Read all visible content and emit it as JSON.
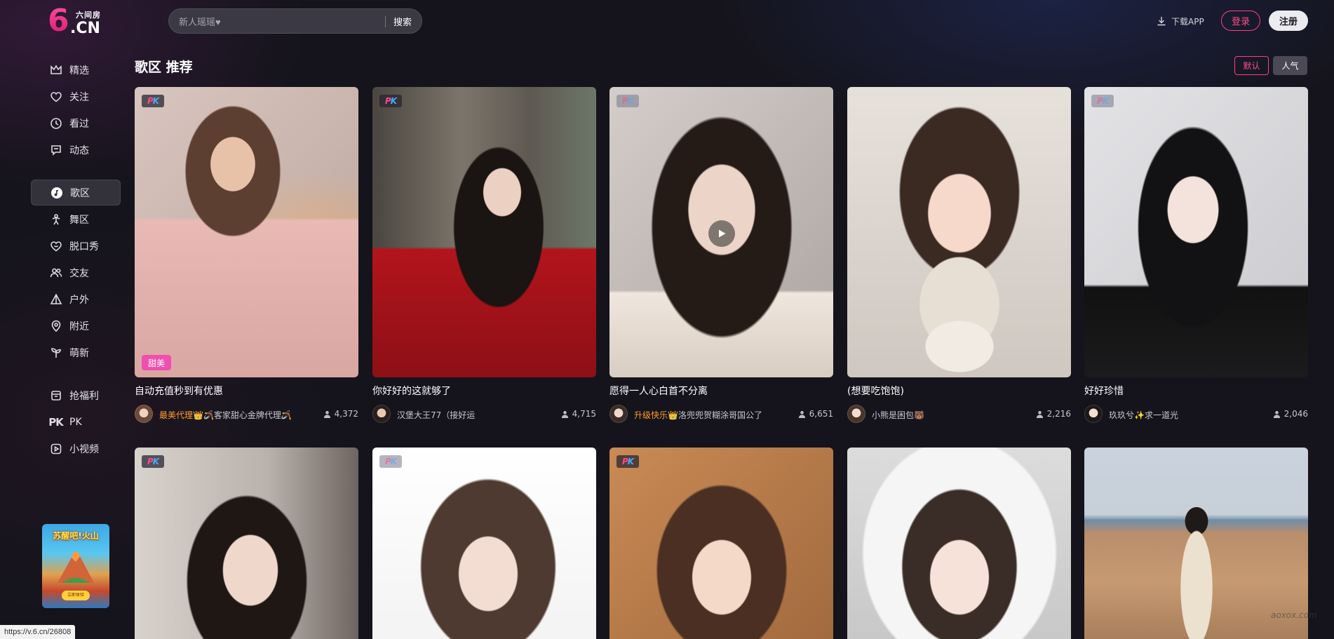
{
  "colors": {
    "accent_pink": "#ff3f7e",
    "background": "#15141c",
    "tag_pink": "#f04fb0",
    "highlight_orange": "#ff9b2a"
  },
  "header": {
    "logo_top": "六间房",
    "logo_six": "6",
    "logo_cn": ".CN",
    "search_placeholder": "新人瑶瑶♥",
    "search_button": "搜索",
    "download_label": "下载APP",
    "login_label": "登录",
    "register_label": "注册"
  },
  "sidebar": {
    "items": [
      {
        "label": "精选",
        "icon": "crown-icon"
      },
      {
        "label": "关注",
        "icon": "heart-icon"
      },
      {
        "label": "看过",
        "icon": "clock-icon"
      },
      {
        "label": "动态",
        "icon": "message-icon"
      },
      {
        "label": "歌区",
        "icon": "music-note-icon",
        "active": true
      },
      {
        "label": "舞区",
        "icon": "dance-icon"
      },
      {
        "label": "脱口秀",
        "icon": "smile-icon"
      },
      {
        "label": "交友",
        "icon": "users-icon"
      },
      {
        "label": "户外",
        "icon": "outdoor-icon"
      },
      {
        "label": "附近",
        "icon": "location-icon"
      },
      {
        "label": "萌新",
        "icon": "sprout-icon"
      },
      {
        "label": "抢福利",
        "icon": "gift-icon"
      },
      {
        "label": "PK",
        "icon": "pk-icon"
      },
      {
        "label": "小视频",
        "icon": "video-icon"
      }
    ],
    "ad_title": "苏醒吧!火山",
    "ad_button": "立即体验"
  },
  "main": {
    "section_title": "歌区 推荐",
    "sort_default": "默认",
    "sort_popular": "人气"
  },
  "cards": [
    {
      "title": "自动充值秒到有优惠",
      "anchor_hl": "最美代理",
      "anchor": "👑🪃客家甜心金牌代理🪃",
      "viewers": "4,372",
      "tag": "甜美"
    },
    {
      "title": "你好好的这就够了",
      "anchor_hl": "",
      "anchor": "汉堡大王77（接好运",
      "viewers": "4,715",
      "tag": ""
    },
    {
      "title": "愿得一人心白首不分离",
      "anchor_hl": "升级快乐",
      "anchor": "👑洛兜兜贺糊涂哥国公了",
      "viewers": "6,651",
      "tag": ""
    },
    {
      "title": "(想要吃饱饱)",
      "anchor_hl": "",
      "anchor": "小熊是困包🐻",
      "viewers": "2,216",
      "tag": ""
    },
    {
      "title": "好好珍惜",
      "anchor_hl": "",
      "anchor": "玖玖兮✨求一道光",
      "viewers": "2,046",
      "tag": ""
    }
  ],
  "status_bar": {
    "url": "https://v.6.cn/26808",
    "watermark": "aoxox.com"
  }
}
